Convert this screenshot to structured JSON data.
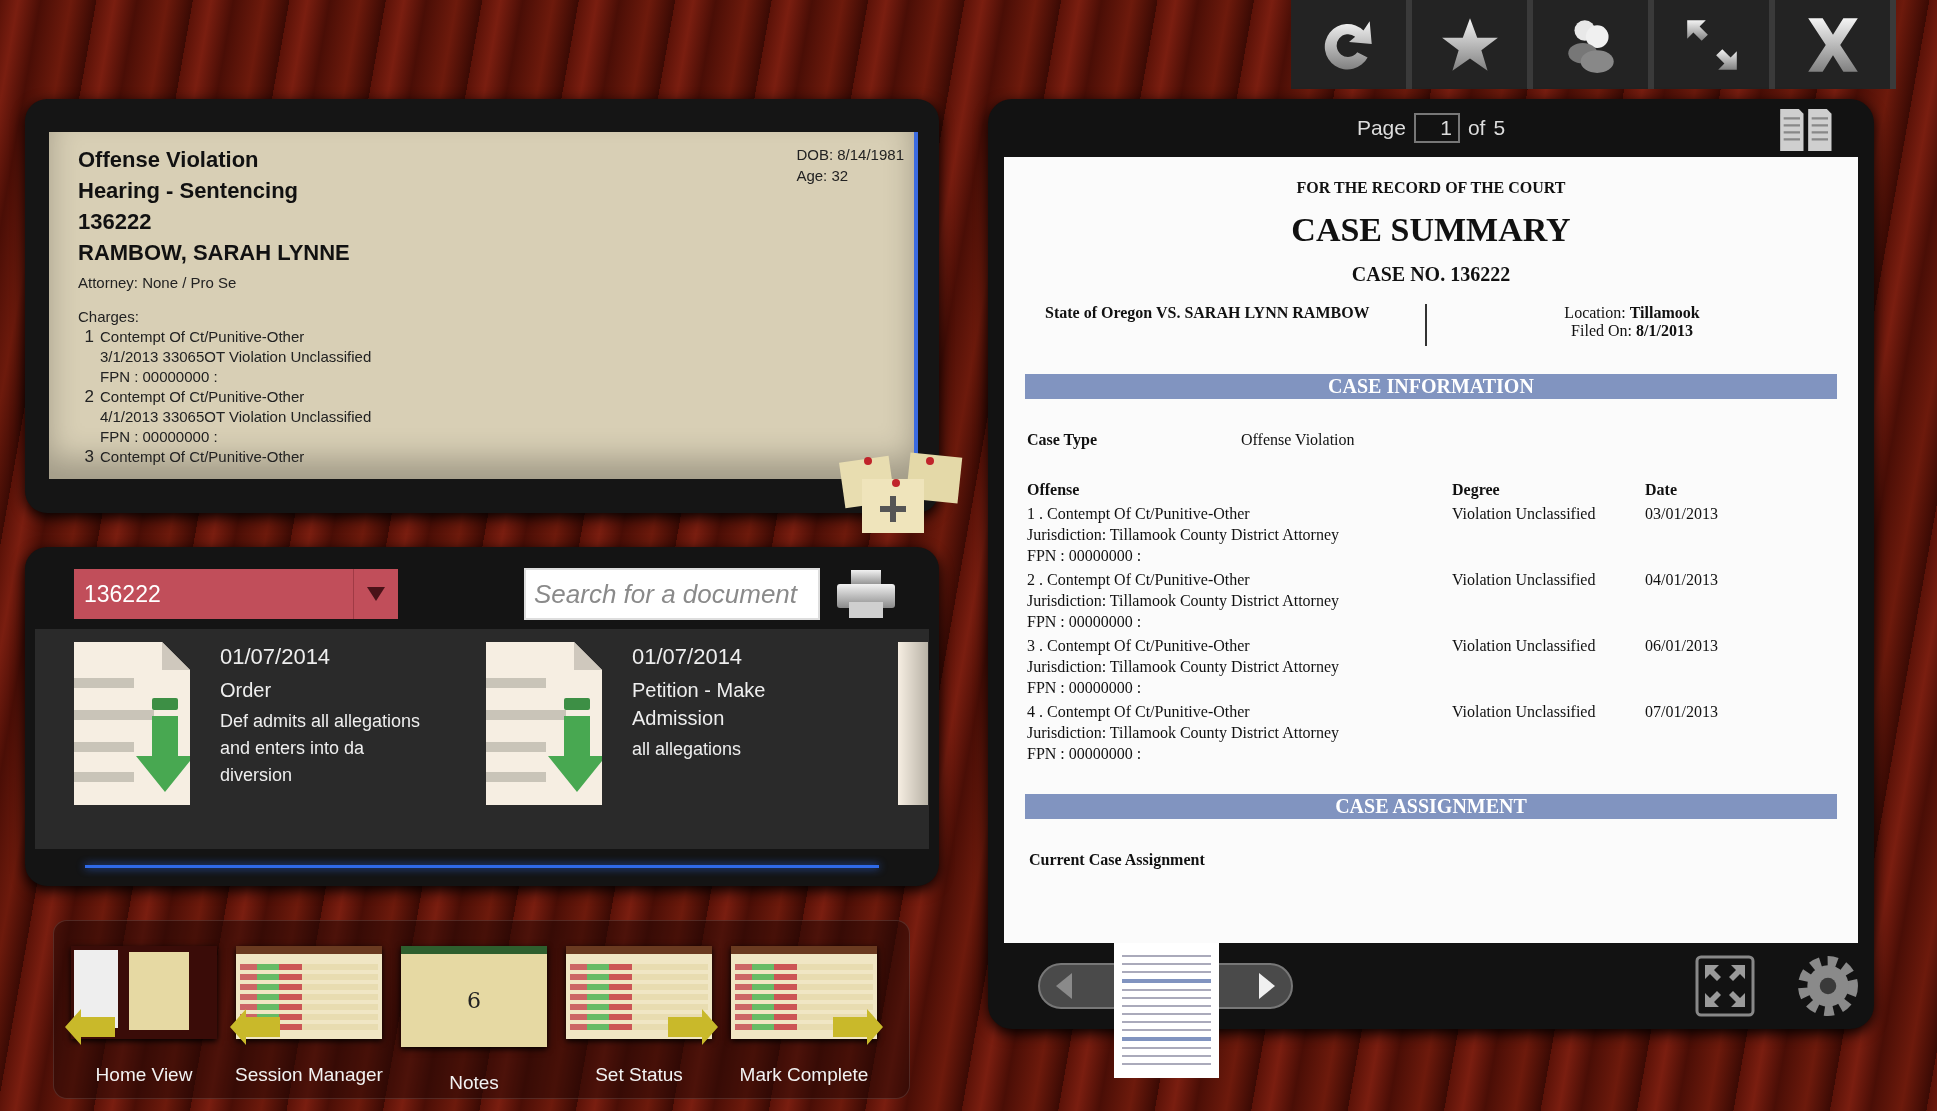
{
  "toolbar": {
    "buttons": [
      {
        "kind": "refresh"
      },
      {
        "kind": "star"
      },
      {
        "kind": "people"
      },
      {
        "kind": "resize"
      },
      {
        "kind": "close"
      }
    ]
  },
  "case_card": {
    "lines": [
      "Offense Violation",
      "Hearing - Sentencing",
      "136222",
      "RAMBOW, SARAH LYNNE"
    ],
    "dob": "DOB: 8/14/1981",
    "age": "Age: 32",
    "attorney": "Attorney: None / Pro Se",
    "charges_label": "Charges:",
    "charges": [
      {
        "number": "1",
        "offense": "Contempt Of Ct/Punitive-Other",
        "detail": "3/1/2013  33065OT  Violation Unclassified",
        "fpn": "FPN : 00000000   :"
      },
      {
        "number": "2",
        "offense": "Contempt Of Ct/Punitive-Other",
        "detail": "4/1/2013  33065OT  Violation Unclassified",
        "fpn": "FPN : 00000000   :"
      },
      {
        "number": "3",
        "offense": "Contempt Of Ct/Punitive-Other"
      }
    ]
  },
  "documents_panel": {
    "case_select": {
      "value": "136222"
    },
    "search": {
      "placeholder": "Search for a document"
    },
    "documents": [
      {
        "date": "01/07/2014",
        "title": "Order",
        "description": "Def admits all allegations and enters into da diversion"
      },
      {
        "date": "01/07/2014",
        "title": "Petition - Make Admission",
        "description": "all allegations"
      }
    ]
  },
  "nav": {
    "items": [
      {
        "label": "Home View",
        "kind": "home",
        "left_arrow": true,
        "right_arrow": false
      },
      {
        "label": "Session Manager",
        "kind": "list",
        "left_arrow": true,
        "right_arrow": false
      },
      {
        "label": "Notes",
        "kind": "notes",
        "left_arrow": false,
        "right_arrow": false,
        "thumbnail_text": "6"
      },
      {
        "label": "Set Status",
        "kind": "list",
        "left_arrow": false,
        "right_arrow": true
      },
      {
        "label": "Mark Complete",
        "kind": "list",
        "left_arrow": false,
        "right_arrow": true
      }
    ]
  },
  "viewer": {
    "page_label": "Page",
    "page": "1",
    "of_label": "of",
    "total": "5",
    "document": {
      "header": "FOR THE RECORD OF THE COURT",
      "title": "CASE SUMMARY",
      "case_no": "CASE NO.  136222",
      "parties": "State of Oregon VS. SARAH LYNN RAMBOW",
      "location": "Location: **Tillamook**",
      "filed": "Filed On: **8/1/2013**",
      "info_heading": "CASE INFORMATION",
      "case_type_label": "Case Type",
      "case_type": "Offense Violation",
      "columns": [
        "Offense",
        "Degree",
        "Date"
      ],
      "offenses": [
        {
          "offense": "1 . Contempt Of Ct/Punitive-Other",
          "jurisdiction": "Jurisdiction: Tillamook County District Attorney",
          "fpn": "FPN : 00000000   :",
          "degree": "Violation Unclassified",
          "date": "03/01/2013"
        },
        {
          "offense": "2 . Contempt Of Ct/Punitive-Other",
          "jurisdiction": "Jurisdiction: Tillamook County District Attorney",
          "fpn": "FPN : 00000000   :",
          "degree": "Violation Unclassified",
          "date": "04/01/2013"
        },
        {
          "offense": "3 . Contempt Of Ct/Punitive-Other",
          "jurisdiction": "Jurisdiction: Tillamook County District Attorney",
          "fpn": "FPN : 00000000   :",
          "degree": "Violation Unclassified",
          "date": "06/01/2013"
        },
        {
          "offense": "4 . Contempt Of Ct/Punitive-Other",
          "jurisdiction": "Jurisdiction: Tillamook County District Attorney",
          "fpn": "FPN : 00000000   :",
          "degree": "Violation Unclassified",
          "date": "07/01/2013"
        }
      ],
      "assignment_heading": "CASE ASSIGNMENT",
      "assignment_label": "Current Case Assignment"
    }
  }
}
